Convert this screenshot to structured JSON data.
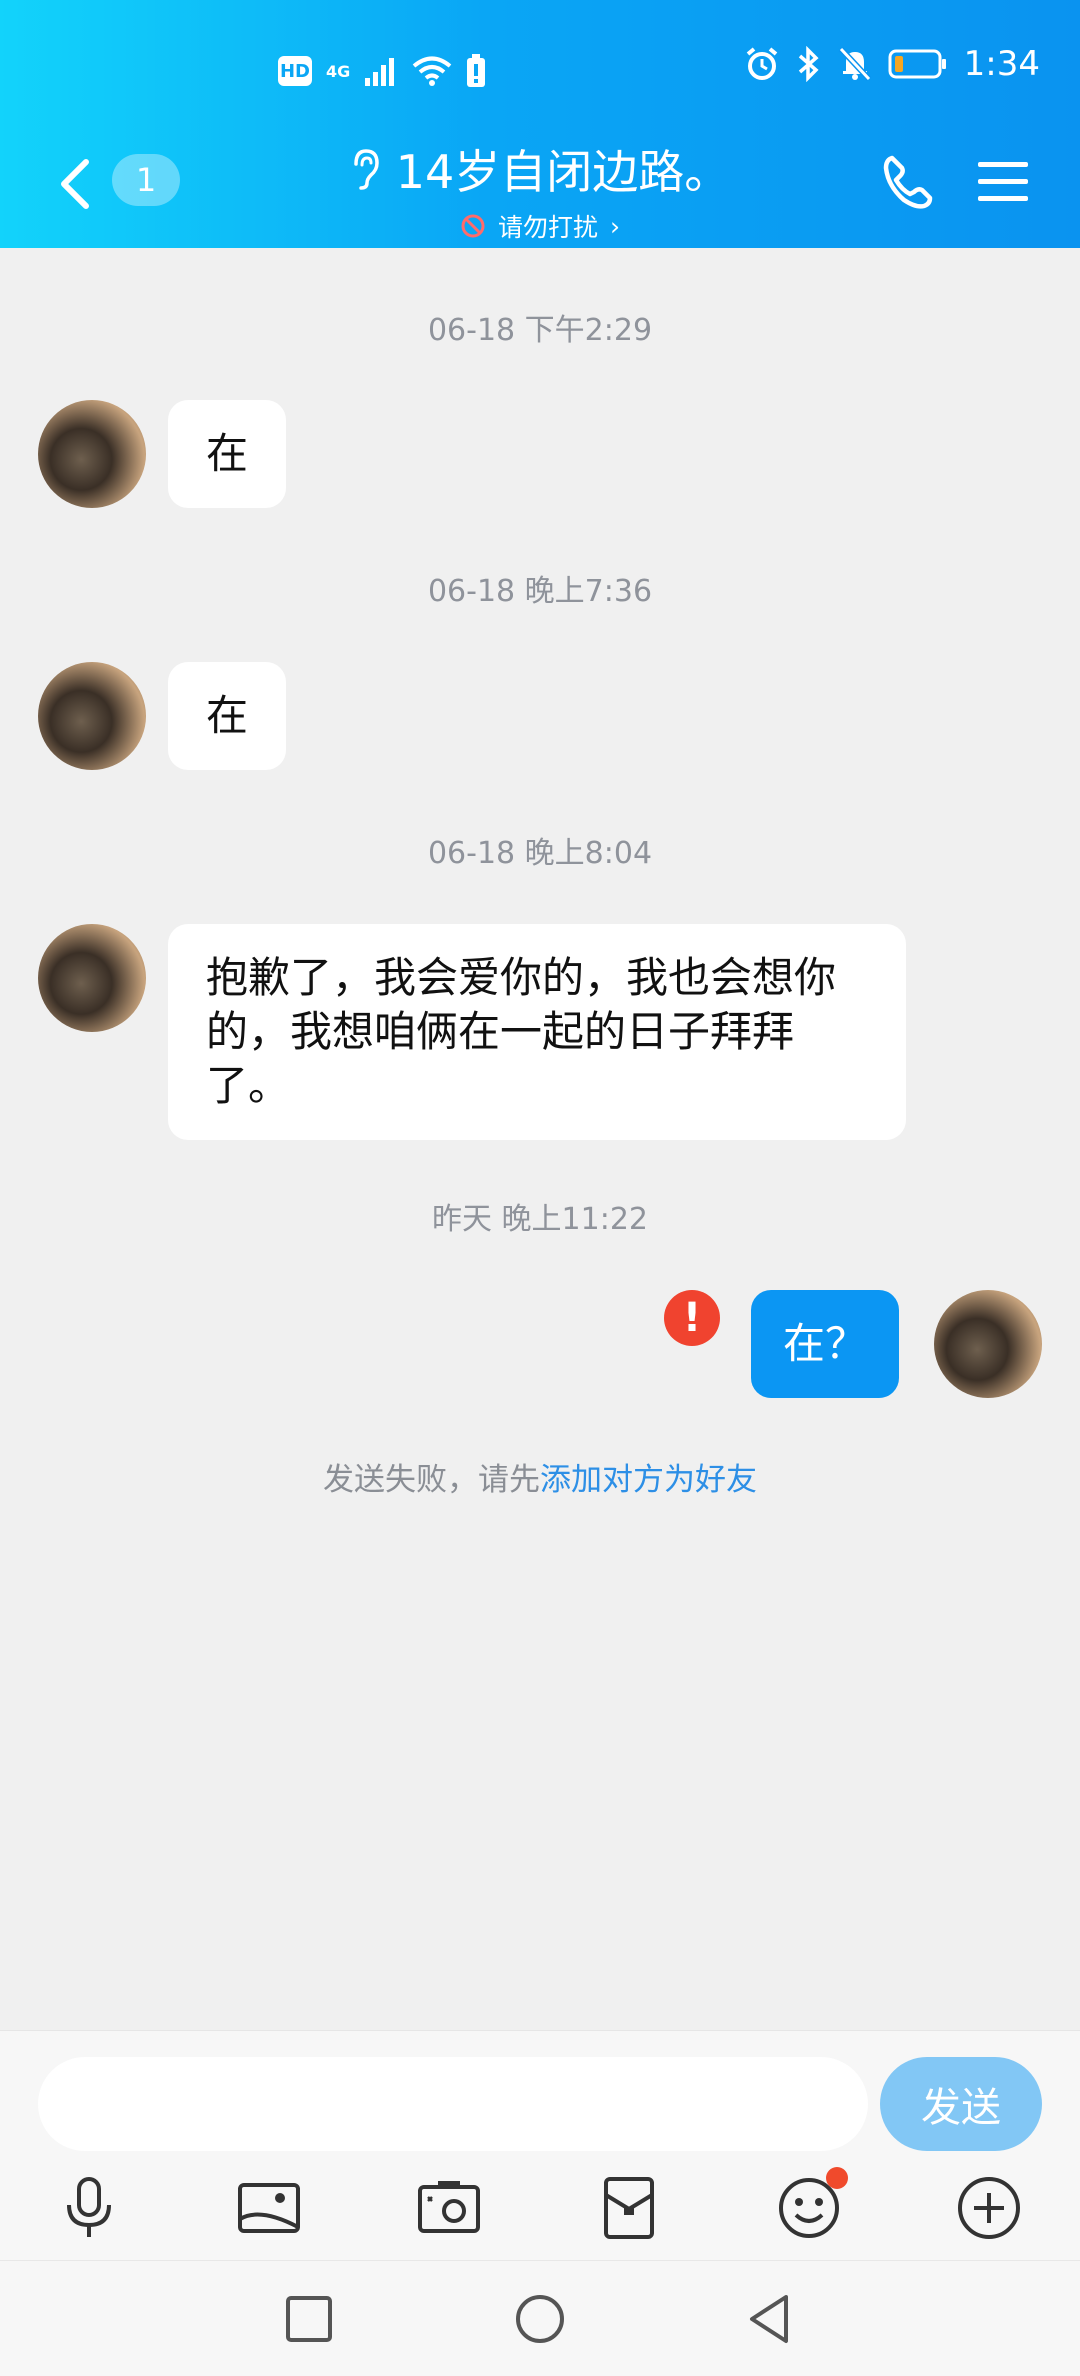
{
  "status_bar": {
    "hd_label": "HD",
    "network_label": "4G",
    "time": "1:34"
  },
  "nav": {
    "unread_count": "1",
    "contact_name": "14岁自闭边路。",
    "dnd_label": "请勿打扰",
    "dnd_chevron": "›"
  },
  "messages": [
    {
      "timestamp": "06-18 下午2:29",
      "text": "在",
      "sender": "contact"
    },
    {
      "timestamp": "06-18 晚上7:36",
      "text": "在",
      "sender": "contact"
    },
    {
      "timestamp": "06-18 晚上8:04",
      "text": "抱歉了，我会爱你的，我也会想你的，我想咱俩在一起的日子拜拜了。",
      "sender": "contact"
    },
    {
      "timestamp": "昨天 晚上11:22",
      "text": "在？",
      "sender": "me"
    }
  ],
  "error_mark": "!",
  "send_fail": {
    "prefix": "发送失败，请先",
    "link": "添加对方为好友"
  },
  "input": {
    "placeholder": "",
    "send_label": "发送"
  },
  "toolbar_icons": [
    "microphone-icon",
    "photo-icon",
    "camera-icon",
    "red-packet-icon",
    "emoji-icon",
    "plus-icon"
  ],
  "colors": {
    "header_start": "#12d3fb",
    "header_end": "#0a93f0",
    "my_bubble": "#0b96f3",
    "error": "#f0432f",
    "link": "#2d8fe6",
    "send_button": "#82c7f5"
  }
}
